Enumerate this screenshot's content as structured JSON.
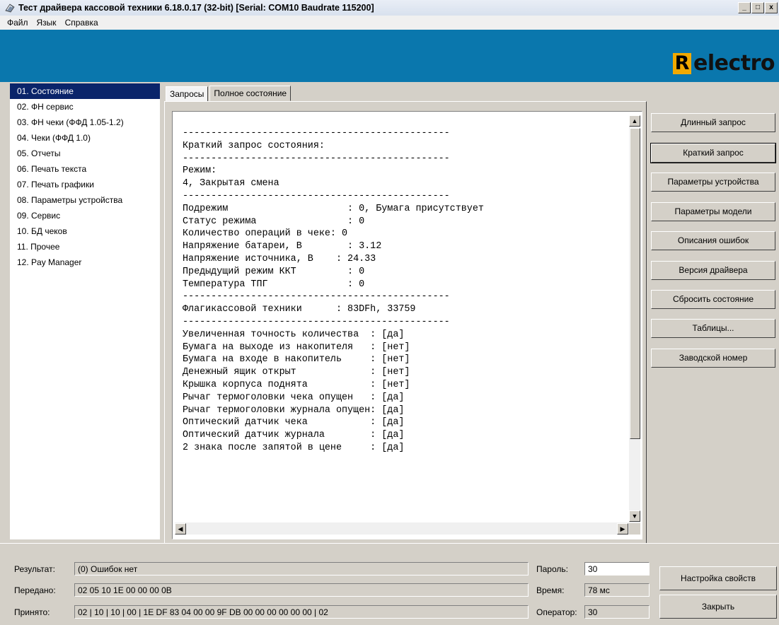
{
  "window": {
    "title": "Тест драйвера кассовой техники 6.18.0.17 (32-bit) [Serial: COM10 Baudrate 115200]",
    "min": "_",
    "max": "□",
    "close": "x"
  },
  "menu": [
    "Файл",
    "Язык",
    "Справка"
  ],
  "logo": {
    "mark": "R",
    "text": "electro"
  },
  "sidebar": {
    "items": [
      {
        "label": "01. Состояние"
      },
      {
        "label": "02. ФН сервис"
      },
      {
        "label": "03. ФН чеки (ФФД 1.05-1.2)"
      },
      {
        "label": "04. Чеки (ФФД 1.0)"
      },
      {
        "label": "05. Отчеты"
      },
      {
        "label": "06. Печать текста"
      },
      {
        "label": "07. Печать графики"
      },
      {
        "label": "08. Параметры устройства"
      },
      {
        "label": "09. Сервис"
      },
      {
        "label": "10. БД чеков"
      },
      {
        "label": "11. Прочее"
      },
      {
        "label": "12. Pay Manager"
      }
    ]
  },
  "tabs": [
    {
      "label": "Запросы"
    },
    {
      "label": "Полное состояние"
    }
  ],
  "output": {
    "text": "-----------------------------------------------\nКраткий запрос состояния:\n-----------------------------------------------\nРежим:\n4, Закрытая смена\n-----------------------------------------------\nПодрежим                     : 0, Бумага присутствует\nСтатус режима                : 0\nКоличество операций в чеке: 0\nНапряжение батареи, В        : 3.12\nНапряжение источника, В    : 24.33\nПредыдущий режим ККТ         : 0\nТемпература ТПГ              : 0\n-----------------------------------------------\nФлагикассовой техники      : 83DFh, 33759\n-----------------------------------------------\nУвеличенная точность количества  : [да]\nБумага на выходе из накопителя   : [нет]\nБумага на входе в накопитель     : [нет]\nДенежный ящик открыт             : [нет]\nКрышка корпуса поднята           : [нет]\nРычаг термоголовки чека опущен   : [да]\nРычаг термоголовки журнала опущен: [да]\nОптический датчик чека           : [да]\nОптический датчик журнала        : [да]\n2 знака после запятой в цене     : [да]"
  },
  "actions": [
    {
      "label": "Длинный запрос"
    },
    {
      "label": "Краткий запрос"
    },
    {
      "label": "Параметры устройства"
    },
    {
      "label": "Параметры модели"
    },
    {
      "label": "Описания ошибок"
    },
    {
      "label": "Версия драйвера"
    },
    {
      "label": "Сбросить состояние"
    },
    {
      "label": "Таблицы..."
    },
    {
      "label": "Заводской номер"
    }
  ],
  "status": {
    "result_label": "Результат:",
    "result": "(0) Ошибок нет",
    "sent_label": "Передано:",
    "sent": "02 05 10 1E 00 00 00 0B",
    "recv_label": "Принято:",
    "recv": "02 | 10 | 10 | 00 | 1E DF 83 04 00 00 9F DB 00 00 00 00 00 00 | 02",
    "password_label": "Пароль:",
    "password": "30",
    "time_label": "Время:",
    "time": "78 мс",
    "operator_label": "Оператор:",
    "operator": "30",
    "settings_button": "Настройка свойств",
    "close_button": "Закрыть"
  }
}
